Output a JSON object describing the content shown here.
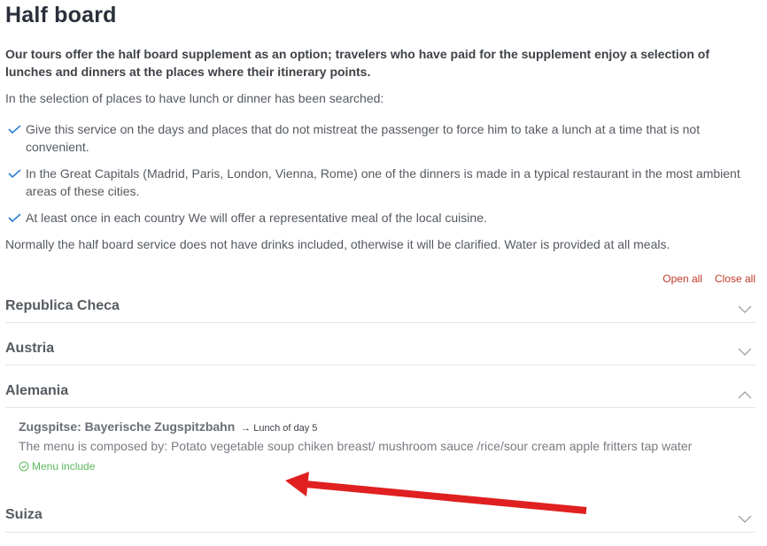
{
  "page": {
    "title": "Half board",
    "intro": "Our tours offer the half board supplement as an option; travelers who have paid for the supplement enjoy a selection of lunches and dinners at the places where their itinerary points.",
    "lead": "In the selection of places to have lunch or dinner has been searched:",
    "bullets": [
      "Give this service on the days and places that do not mistreat the passenger to force him to take a lunch at a time that is not convenient.",
      "In the Great Capitals (Madrid, Paris, London, Vienna, Rome) one of the dinners is made in a typical restaurant in the most ambient areas of these cities.",
      "At least once in each country We will offer a representative meal of the local cuisine."
    ],
    "note": "Normally the half board service does not have drinks included, otherwise it will be clarified. Water is provided at all meals."
  },
  "controls": {
    "open_all": "Open all",
    "close_all": "Close all"
  },
  "accordion": [
    {
      "title": "Republica Checa",
      "expanded": false
    },
    {
      "title": "Austria",
      "expanded": false
    },
    {
      "title": "Alemania",
      "expanded": true
    },
    {
      "title": "Suiza",
      "expanded": false
    }
  ],
  "detail": {
    "place": "Zugspitse: Bayerische Zugspitzbahn",
    "meal": "Lunch of day 5",
    "menu": "The menu is composed by: Potato vegetable soup chiken breast/ mushroom sauce /rice/sour cream apple fritters tap water",
    "included": "Menu include"
  },
  "colors": {
    "accent": "#c0392b",
    "check": "#2f7fd1",
    "included": "#5cb85c",
    "annotation_arrow": "#e02020"
  },
  "icons": {
    "bullet": "check-icon",
    "collapsed": "chevron-down-icon",
    "expanded": "chevron-up-icon",
    "included": "check-circle-icon",
    "meal": "arrow-right-icon"
  }
}
